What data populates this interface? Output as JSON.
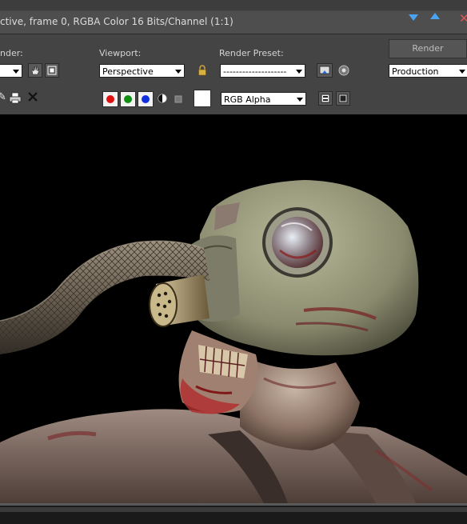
{
  "window": {
    "title": "ctive, frame 0, RGBA Color 16 Bits/Channel (1:1)",
    "controls": [
      "minimize-icon",
      "restore-icon",
      "close-icon"
    ]
  },
  "toolbar": {
    "area_to_render_label": "nder:",
    "area_to_render_value": "",
    "viewport_label": "Viewport:",
    "viewport_value": "Perspective",
    "render_preset_label": "Render Preset:",
    "render_preset_value": "--------------------",
    "render_button": "Render",
    "render_mode_value": "Production",
    "channel_value": "RGB Alpha"
  },
  "colors": {
    "red_channel": "#e01010",
    "green_channel": "#109010",
    "blue_channel": "#1030e0",
    "accent_arrows": "#4aa3f0",
    "close": "#e05555"
  }
}
